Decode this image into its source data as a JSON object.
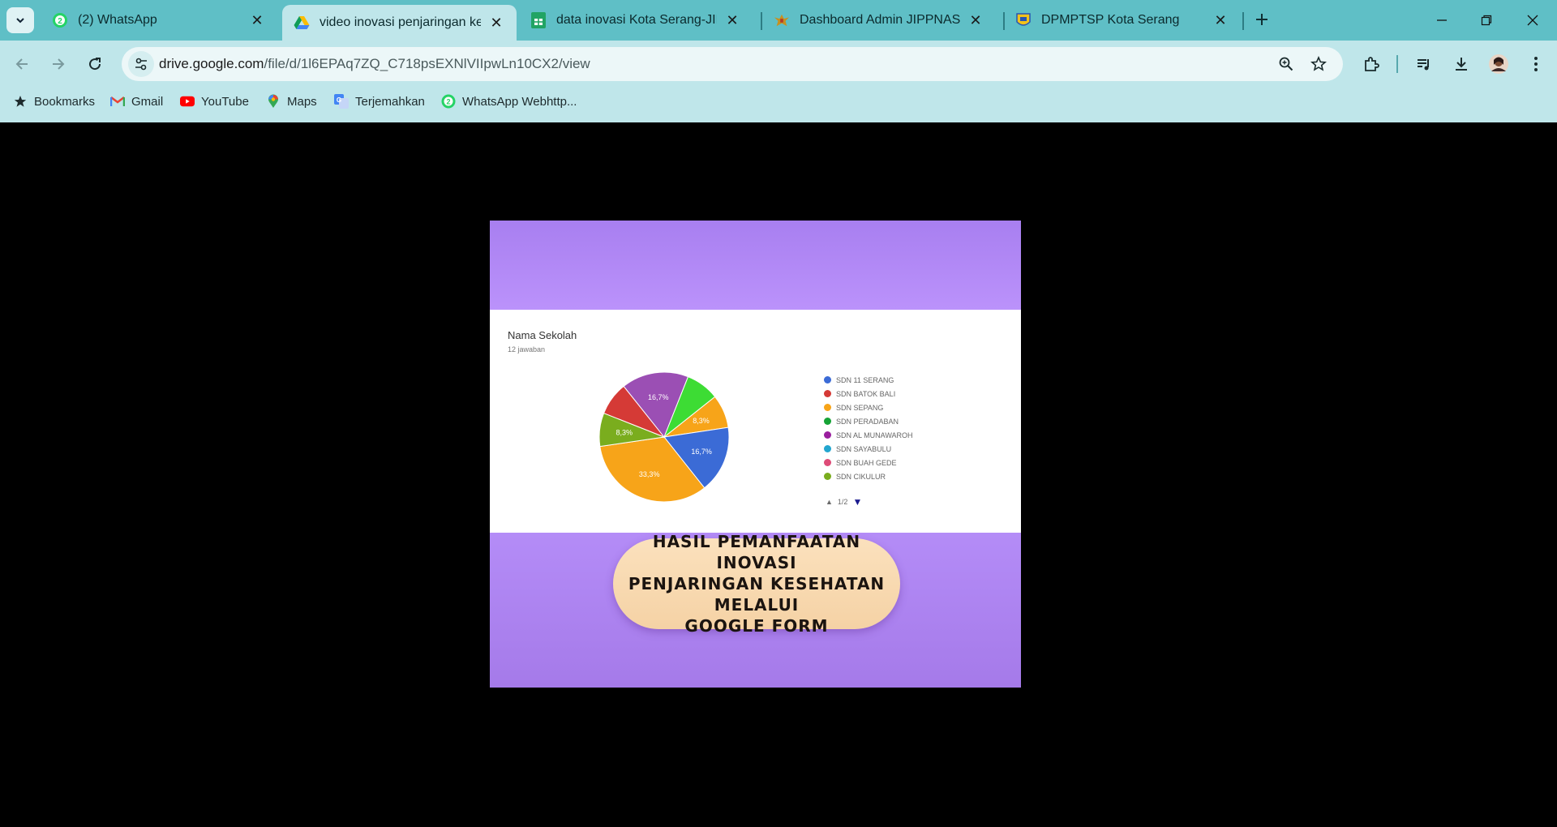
{
  "tabs": [
    {
      "title": "(2) WhatsApp",
      "favicon": "whatsapp-icon",
      "active": false
    },
    {
      "title": "video inovasi penjaringan kesehatan",
      "favicon": "google-drive-icon",
      "active": true
    },
    {
      "title": "data inovasi Kota Serang-JIPPNAS",
      "favicon": "google-sheets-icon",
      "active": false
    },
    {
      "title": "Dashboard Admin JIPPNAS",
      "favicon": "garuda-icon",
      "active": false
    },
    {
      "title": "DPMPTSP Kota Serang",
      "favicon": "kota-serang-icon",
      "active": false
    }
  ],
  "address": {
    "host": "drive.google.com",
    "path": "/file/d/1l6EPAq7ZQ_C718psEXNlVIIpwLn10CX2/view"
  },
  "bookmarks": [
    {
      "label": "Bookmarks",
      "icon": "star-icon"
    },
    {
      "label": "Gmail",
      "icon": "gmail-icon"
    },
    {
      "label": "YouTube",
      "icon": "youtube-icon"
    },
    {
      "label": "Maps",
      "icon": "maps-icon"
    },
    {
      "label": "Terjemahkan",
      "icon": "translate-icon"
    },
    {
      "label": "WhatsApp Webhttp...",
      "icon": "whatsapp-icon"
    }
  ],
  "video": {
    "question_title": "Nama Sekolah",
    "question_subtitle": "12 jawaban",
    "pager": "1/2",
    "banner_lines": [
      "HASIL PEMANFAATAN INOVASI",
      "PENJARINGAN KESEHATAN MELALUI",
      "GOOGLE FORM"
    ]
  },
  "chart_data": {
    "type": "pie",
    "title": "Nama Sekolah",
    "categories": [
      "SDN 11 SERANG",
      "SDN BATOK BALI",
      "SDN SEPANG",
      "SDN PERADABAN",
      "SDN AL MUNAWAROH",
      "SDN SAYABULU",
      "SDN BUAH GEDE",
      "SDN CIKULUR"
    ],
    "colors": [
      "#3b6bd6",
      "#d53a36",
      "#f7a419",
      "#16a336",
      "#9a1f9e",
      "#23a6cf",
      "#de4c78",
      "#7aad1e"
    ],
    "slices": [
      {
        "label": "SDN SEPANG",
        "value": 8.3,
        "color": "#f7a419",
        "text": "8,3%"
      },
      {
        "label": "SDN 11 SERANG",
        "value": 16.7,
        "color": "#3b6bd6",
        "text": "16,7%"
      },
      {
        "label": "SDN SEPANG",
        "value": 33.3,
        "color": "#f7a419",
        "text": "33,3%"
      },
      {
        "label": "SDN CIKULUR",
        "value": 8.3,
        "color": "#7aad1e",
        "text": "8,3%"
      },
      {
        "label": "SDN BATOK BALI",
        "value": 8.3,
        "color": "#d53a36",
        "text": ""
      },
      {
        "label": "SDN AL MUNAWAROH",
        "value": 16.7,
        "color": "#9b4fb4",
        "text": "16,7%"
      },
      {
        "label": "SDN PERADABAN",
        "value": 8.3,
        "color": "#3ddc34",
        "text": ""
      }
    ]
  }
}
